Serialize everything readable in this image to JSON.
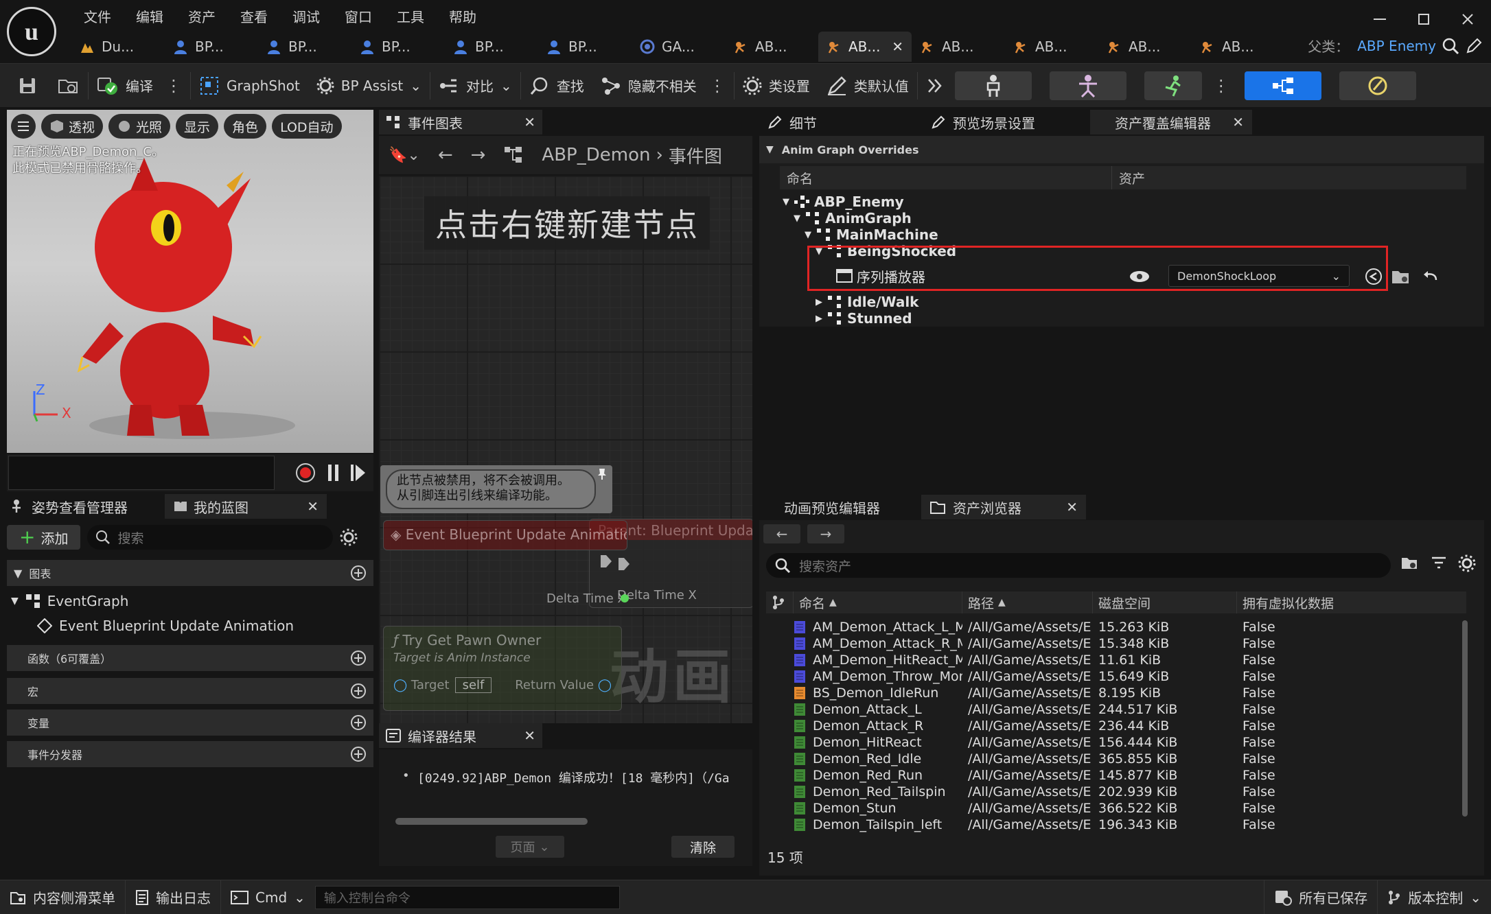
{
  "menu": [
    "文件",
    "编辑",
    "资产",
    "查看",
    "调试",
    "窗口",
    "工具",
    "帮助"
  ],
  "doc_tabs": [
    {
      "label": "Du...",
      "icon": "level-icon"
    },
    {
      "label": "BP...",
      "icon": "blueprint-icon"
    },
    {
      "label": "BP...",
      "icon": "blueprint-icon"
    },
    {
      "label": "BP...",
      "icon": "blueprint-icon"
    },
    {
      "label": "BP...",
      "icon": "blueprint-icon"
    },
    {
      "label": "BP...",
      "icon": "blueprint-icon"
    },
    {
      "label": "GA...",
      "icon": "ability-icon"
    },
    {
      "label": "AB...",
      "icon": "anim-blueprint-icon"
    },
    {
      "label": "AB...",
      "icon": "anim-blueprint-icon",
      "active": true
    },
    {
      "label": "AB...",
      "icon": "anim-blueprint-icon"
    },
    {
      "label": "AB...",
      "icon": "anim-blueprint-icon"
    },
    {
      "label": "AB...",
      "icon": "anim-blueprint-icon"
    },
    {
      "label": "AB...",
      "icon": "anim-blueprint-icon"
    }
  ],
  "parent_class": {
    "label": "父类：",
    "value": "ABP Enemy"
  },
  "toolbar": {
    "compile": "编译",
    "graphshot": "GraphShot",
    "bp_assist": "BP Assist",
    "diff": "对比",
    "find": "查找",
    "hide_unrelated": "隐藏不相关",
    "class_settings": "类设置",
    "class_defaults": "类默认值"
  },
  "viewport": {
    "buttons": [
      "透视",
      "光照",
      "显示",
      "角色",
      "LOD自动"
    ],
    "note_line1": "正在预览ABP_Demon_C。",
    "note_line2": "此模式已禁用骨骼操作。",
    "axis_z": "Z",
    "axis_x": "X"
  },
  "event_graph": {
    "tab": "事件图表",
    "breadcrumb_root": "ABP_Demon",
    "breadcrumb_child": "事件图",
    "hint": "点击右键新建节点",
    "watermark": "动画",
    "disabled_line1": "此节点被禁用，将不会被调用。",
    "disabled_line2": "从引脚连出引线来编译功能。",
    "event_node": "Event Blueprint Update Animation",
    "parent_node": "Parent: Blueprint Upda",
    "delta_time_a": "Delta Time X",
    "delta_time_b": "Delta Time X",
    "pawn_node": "Try Get Pawn Owner",
    "pawn_sub": "Target is Anim Instance",
    "target": "Target",
    "self": "self",
    "return_value": "Return Value"
  },
  "compiler": {
    "tab": "编译器结果",
    "line": "[0249.92]ABP_Demon 编译成功！[18 毫秒内]（/Ga",
    "page": "页面",
    "clear": "清除"
  },
  "left_panel": {
    "tabs": [
      "姿势查看管理器",
      "我的蓝图"
    ],
    "add": "添加",
    "search_placeholder": "搜索",
    "sections": {
      "graphs": "图表",
      "functions": "函数（6可覆盖）",
      "macros": "宏",
      "variables": "变量",
      "dispatchers": "事件分发器"
    },
    "event_graph": "EventGraph",
    "event_item": "Event Blueprint Update Animation"
  },
  "right_tabs": [
    "细节",
    "预览场景设置",
    "资产覆盖编辑器"
  ],
  "overrides": {
    "header": "Anim Graph Overrides",
    "col_name": "命名",
    "col_asset": "资产",
    "tree": [
      "ABP_Enemy",
      "AnimGraph",
      "MainMachine",
      "BeingShocked"
    ],
    "player": "序列播放器",
    "asset_value": "DemonShockLoop",
    "others": [
      "Idle/Walk",
      "Stunned"
    ]
  },
  "content_browser": {
    "tabs": [
      "动画预览编辑器",
      "资产浏览器"
    ],
    "search_placeholder": "搜索资产",
    "columns": {
      "name": "命名",
      "path": "路径",
      "disk": "磁盘空间",
      "virtual": "拥有虚拟化数据"
    },
    "rows": [
      {
        "name": "AM_Demon_Attack_L_Montage",
        "path": "/All/Game/Assets/E",
        "disk": "15.263 KiB",
        "virtual": "False",
        "kind": "montage"
      },
      {
        "name": "AM_Demon_Attack_R_Montage",
        "path": "/All/Game/Assets/E",
        "disk": "15.348 KiB",
        "virtual": "False",
        "kind": "montage"
      },
      {
        "name": "AM_Demon_HitReact_Montage",
        "path": "/All/Game/Assets/E",
        "disk": "11.61 KiB",
        "virtual": "False",
        "kind": "montage"
      },
      {
        "name": "AM_Demon_Throw_Montage",
        "path": "/All/Game/Assets/E",
        "disk": "15.649 KiB",
        "virtual": "False",
        "kind": "montage"
      },
      {
        "name": "BS_Demon_IdleRun",
        "path": "/All/Game/Assets/E",
        "disk": "8.195 KiB",
        "virtual": "False",
        "kind": "blendspace"
      },
      {
        "name": "Demon_Attack_L",
        "path": "/All/Game/Assets/E",
        "disk": "244.517 KiB",
        "virtual": "False",
        "kind": "sequence"
      },
      {
        "name": "Demon_Attack_R",
        "path": "/All/Game/Assets/E",
        "disk": "236.44 KiB",
        "virtual": "False",
        "kind": "sequence"
      },
      {
        "name": "Demon_HitReact",
        "path": "/All/Game/Assets/E",
        "disk": "156.444 KiB",
        "virtual": "False",
        "kind": "sequence"
      },
      {
        "name": "Demon_Red_Idle",
        "path": "/All/Game/Assets/E",
        "disk": "365.855 KiB",
        "virtual": "False",
        "kind": "sequence"
      },
      {
        "name": "Demon_Red_Run",
        "path": "/All/Game/Assets/E",
        "disk": "145.877 KiB",
        "virtual": "False",
        "kind": "sequence"
      },
      {
        "name": "Demon_Red_Tailspin",
        "path": "/All/Game/Assets/E",
        "disk": "202.939 KiB",
        "virtual": "False",
        "kind": "sequence"
      },
      {
        "name": "Demon_Stun",
        "path": "/All/Game/Assets/E",
        "disk": "366.522 KiB",
        "virtual": "False",
        "kind": "sequence"
      },
      {
        "name": "Demon_Tailspin_left",
        "path": "/All/Game/Assets/E",
        "disk": "196.343 KiB",
        "virtual": "False",
        "kind": "sequence"
      }
    ],
    "count": "15 项"
  },
  "statusbar": {
    "content_drawer": "内容侧滑菜单",
    "output_log": "输出日志",
    "cmd": "Cmd",
    "console_placeholder": "输入控制台命令",
    "all_saved": "所有已保存",
    "source_control": "版本控制"
  },
  "colors": {
    "accent": "#1a74e8",
    "highlight": "#e02424",
    "link": "#5aa9ff",
    "montage": "#4b4bd9",
    "blendspace": "#e68a2e",
    "sequence": "#3f8a36"
  }
}
